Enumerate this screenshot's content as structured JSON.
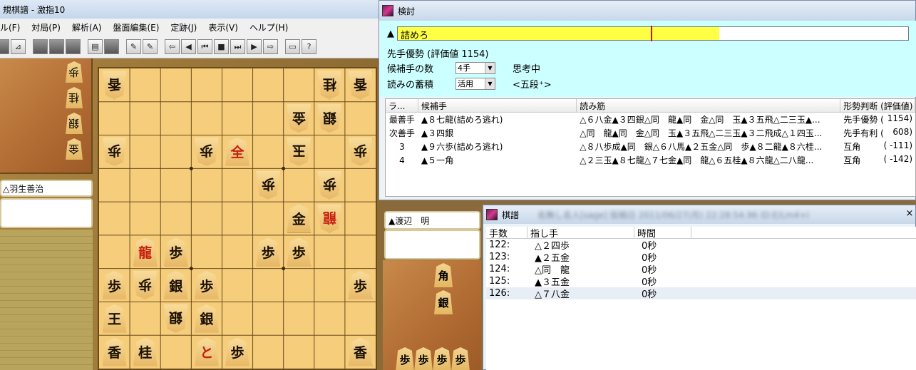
{
  "main_window": {
    "title": "規棋譜 - 激指10",
    "menu": [
      "ル(F)",
      "対局(P)",
      "解析(A)",
      "盤面編集(E)",
      "定跡(J)",
      "表示(V)",
      "ヘルプ(H)"
    ]
  },
  "players": {
    "gote": "△羽生善治",
    "sente": "▲渡辺　明"
  },
  "gote_hand": [
    "歩",
    "桂",
    "銀",
    "金"
  ],
  "sente_hand": [
    "角",
    "銀",
    "歩",
    "歩",
    "歩",
    "歩"
  ],
  "board": [
    {
      "col": 0,
      "row": 0,
      "p": "香",
      "side": "gote"
    },
    {
      "col": 7,
      "row": 0,
      "p": "桂",
      "side": "gote"
    },
    {
      "col": 8,
      "row": 0,
      "p": "香",
      "side": "gote"
    },
    {
      "col": 6,
      "row": 1,
      "p": "金",
      "side": "gote"
    },
    {
      "col": 7,
      "row": 1,
      "p": "銀",
      "side": "gote"
    },
    {
      "col": 0,
      "row": 2,
      "p": "歩",
      "side": "gote"
    },
    {
      "col": 3,
      "row": 2,
      "p": "歩",
      "side": "gote"
    },
    {
      "col": 4,
      "row": 2,
      "p": "全",
      "side": "sente",
      "promoted": true
    },
    {
      "col": 6,
      "row": 2,
      "p": "玉",
      "side": "gote"
    },
    {
      "col": 8,
      "row": 2,
      "p": "歩",
      "side": "gote"
    },
    {
      "col": 5,
      "row": 3,
      "p": "歩",
      "side": "gote"
    },
    {
      "col": 7,
      "row": 3,
      "p": "歩",
      "side": "gote"
    },
    {
      "col": 6,
      "row": 4,
      "p": "金",
      "side": "sente"
    },
    {
      "col": 7,
      "row": 4,
      "p": "龍",
      "side": "gote",
      "promoted": true
    },
    {
      "col": 1,
      "row": 5,
      "p": "龍",
      "side": "sente",
      "promoted": true
    },
    {
      "col": 2,
      "row": 5,
      "p": "歩",
      "side": "sente"
    },
    {
      "col": 5,
      "row": 5,
      "p": "歩",
      "side": "sente"
    },
    {
      "col": 6,
      "row": 5,
      "p": "歩",
      "side": "sente"
    },
    {
      "col": 0,
      "row": 6,
      "p": "歩",
      "side": "sente"
    },
    {
      "col": 1,
      "row": 6,
      "p": "歩",
      "side": "gote"
    },
    {
      "col": 2,
      "row": 6,
      "p": "銀",
      "side": "sente"
    },
    {
      "col": 3,
      "row": 6,
      "p": "歩",
      "side": "sente"
    },
    {
      "col": 8,
      "row": 6,
      "p": "歩",
      "side": "sente"
    },
    {
      "col": 0,
      "row": 7,
      "p": "王",
      "side": "sente"
    },
    {
      "col": 2,
      "row": 7,
      "p": "銀",
      "side": "gote"
    },
    {
      "col": 3,
      "row": 7,
      "p": "銀",
      "side": "sente"
    },
    {
      "col": 0,
      "row": 8,
      "p": "香",
      "side": "sente"
    },
    {
      "col": 1,
      "row": 8,
      "p": "桂",
      "side": "sente"
    },
    {
      "col": 3,
      "row": 8,
      "p": "と",
      "side": "sente",
      "promoted": true
    },
    {
      "col": 4,
      "row": 8,
      "p": "歩",
      "side": "sente"
    },
    {
      "col": 8,
      "row": 8,
      "p": "香",
      "side": "sente"
    }
  ],
  "analysis": {
    "title": "検討",
    "side_mark": "▲",
    "bar_label": "詰めろ",
    "eval_fraction": 0.63,
    "eval_text": "先手優勢 (評価値 1154)",
    "candidates_label": "候補手の数",
    "candidates_value": "4手",
    "accumulate_label": "読みの蓄積",
    "accumulate_value": "活用",
    "status": "思考中",
    "level": "<五段⁺>",
    "table": {
      "headers": [
        "ラ...",
        "候補手",
        "読み筋",
        "形勢判断 (評価値)"
      ],
      "rows": [
        {
          "rank": "最善手",
          "move": "▲８七龍(詰めろ逃れ)",
          "pv": "△６八金▲３四銀△同　龍▲同　金△同　玉▲３五飛△二三玉▲...",
          "judge": "先手優勢 (",
          "value": "1154)"
        },
        {
          "rank": "次善手",
          "move": "▲３四銀",
          "pv": "△同　龍▲同　金△同　玉▲３五飛△二三玉▲３二飛成△１四玉...",
          "judge": "先手有利 (",
          "value": "608)"
        },
        {
          "rank": "3",
          "move": "▲９六歩(詰めろ逃れ)",
          "pv": "△８八歩成▲同　銀△６八馬▲２五金△同　歩▲８二龍▲８六桂...",
          "judge": "互角",
          "value": "(  -111)"
        },
        {
          "rank": "4",
          "move": "▲５一角",
          "pv": "△２三玉▲８七龍△７七金▲同　龍△６五桂▲８六龍△二八龍...",
          "judge": "互角",
          "value": "(  -142)"
        }
      ]
    }
  },
  "kifu": {
    "title": "棋譜",
    "blurred_text": "名無し名人[sage] 投稿日 2011/06/27(月) 22:28:54.96 ID:E/Lm4+I",
    "close": "×",
    "headers": [
      "手数",
      "指し手",
      "時間"
    ],
    "rows": [
      {
        "num": "122:",
        "move": "△２四歩",
        "time": "0秒"
      },
      {
        "num": "123:",
        "move": "▲２五金",
        "time": "0秒"
      },
      {
        "num": "124:",
        "move": "△同　龍",
        "time": "0秒"
      },
      {
        "num": "125:",
        "move": "▲３五金",
        "time": "0秒"
      },
      {
        "num": "126:",
        "move": "△７八金",
        "time": "0秒"
      }
    ]
  }
}
